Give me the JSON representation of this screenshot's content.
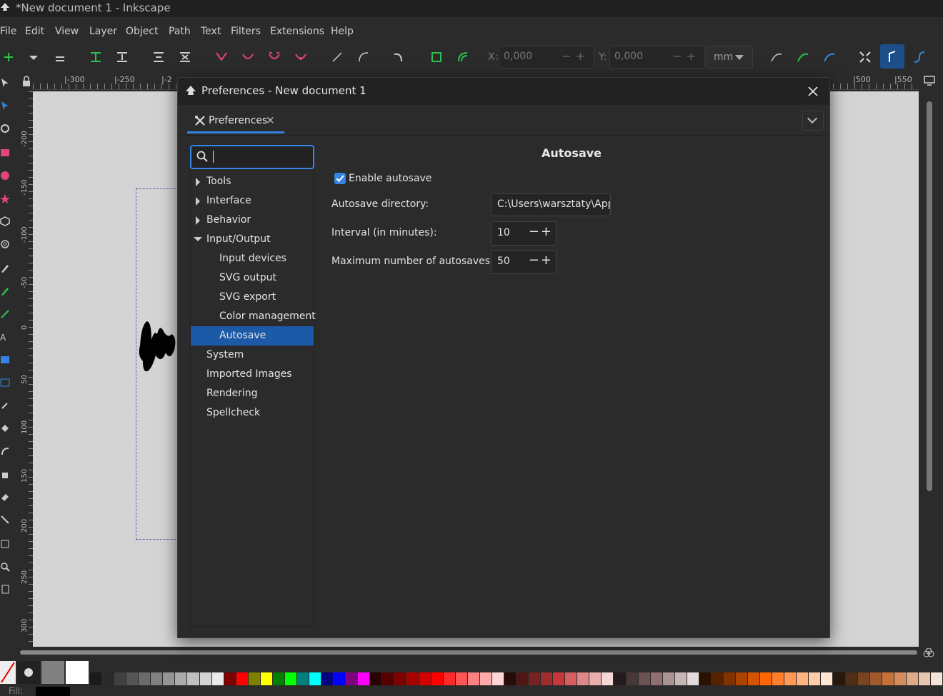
{
  "window": {
    "title": "*New document 1 - Inkscape"
  },
  "menu": [
    "File",
    "Edit",
    "View",
    "Layer",
    "Object",
    "Path",
    "Text",
    "Filters",
    "Extensions",
    "Help"
  ],
  "toolbar": {
    "x_label": "X:",
    "x_value": "0,000",
    "y_label": "Y:",
    "y_value": "0,000",
    "unit": "mm"
  },
  "ruler": {
    "h_labels": [
      "|-300",
      "|-250",
      "|-2",
      "|500",
      "|550"
    ],
    "v_labels": [
      "-200",
      "-150",
      "-100",
      "-50",
      "0",
      "50",
      "100",
      "150",
      "200",
      "250",
      "300"
    ]
  },
  "dialog": {
    "title": "Preferences - New document 1",
    "tab_label": "Preferences",
    "tree": [
      {
        "label": "Tools",
        "level": 0,
        "arrow": "right"
      },
      {
        "label": "Interface",
        "level": 0,
        "arrow": "right"
      },
      {
        "label": "Behavior",
        "level": 0,
        "arrow": "right"
      },
      {
        "label": "Input/Output",
        "level": 0,
        "arrow": "down"
      },
      {
        "label": "Input devices",
        "level": 1
      },
      {
        "label": "SVG output",
        "level": 1
      },
      {
        "label": "SVG export",
        "level": 1
      },
      {
        "label": "Color management",
        "level": 1
      },
      {
        "label": "Autosave",
        "level": 1,
        "selected": true
      },
      {
        "label": "System",
        "level": 0
      },
      {
        "label": "Imported Images",
        "level": 0
      },
      {
        "label": "Rendering",
        "level": 0
      },
      {
        "label": "Spellcheck",
        "level": 0
      }
    ],
    "panel": {
      "title": "Autosave",
      "enable_label": "Enable autosave",
      "enable_checked": true,
      "directory_label": "Autosave directory:",
      "directory_value": "C:\\Users\\warsztaty\\App",
      "interval_label": "Interval (in minutes):",
      "interval_value": "10",
      "max_label": "Maximum number of autosaves:",
      "max_value": "50"
    }
  },
  "status": {
    "fill_label": "Fill:"
  },
  "colors": {
    "accent": "#3584e4",
    "selection": "#1c5aa8"
  }
}
